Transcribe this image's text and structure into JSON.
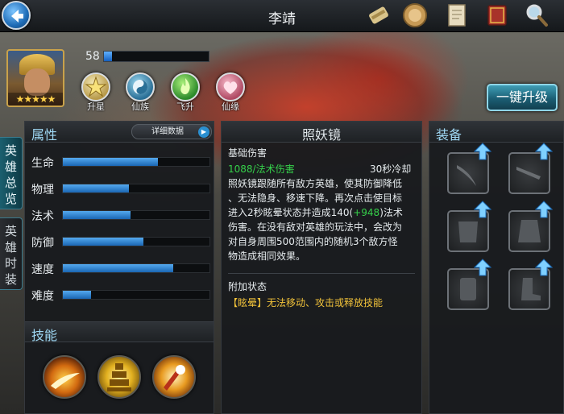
{
  "header": {
    "title": "李靖",
    "icons": [
      "scroll-icon",
      "badge-icon",
      "document-icon",
      "book-icon",
      "magnifier-icon"
    ]
  },
  "hero": {
    "stars": "★★★★★",
    "level": "58",
    "level_progress": 0.08,
    "actions": [
      {
        "label": "升星",
        "icon": "star-icon"
      },
      {
        "label": "仙族",
        "icon": "taiji-icon"
      },
      {
        "label": "飞升",
        "icon": "flame-icon"
      },
      {
        "label": "仙缘",
        "icon": "heart-icon"
      }
    ],
    "upgrade_button": "一键升级"
  },
  "side_tabs": [
    {
      "label": "英雄总览",
      "active": true
    },
    {
      "label": "英雄时装",
      "active": false
    }
  ],
  "attributes": {
    "title": "属性",
    "detail_button": "详细数据",
    "stats": [
      {
        "name": "生命",
        "value": 0.65
      },
      {
        "name": "物理",
        "value": 0.45
      },
      {
        "name": "法术",
        "value": 0.46
      },
      {
        "name": "防御",
        "value": 0.55
      },
      {
        "name": "速度",
        "value": 0.75
      },
      {
        "name": "难度",
        "value": 0.19
      }
    ]
  },
  "skills": {
    "title": "技能",
    "icons": [
      "slash-skill-icon",
      "pagoda-skill-icon",
      "burst-skill-icon"
    ]
  },
  "skill_detail": {
    "title": "照妖镜",
    "type": "基础伤害",
    "damage_text": "1088/法术伤害",
    "cooldown": "30秒冷却",
    "desc_1": "照妖镜跟随所有敌方英雄，使其防御降低",
    "desc_2": "、无法隐身、移速下降。再次点击使目标",
    "desc_3a": "进入2秒眩晕状态并造成140(",
    "desc_3b": "+948",
    "desc_3c": ")法术",
    "desc_4": "伤害。在没有敌对英雄的玩法中，会改为",
    "desc_5": "对自身周围500范围内的随机3个敌方怪",
    "desc_6": "物造成相同效果。",
    "extra_title": "附加状态",
    "extra_text": "【眩晕】无法移动、攻击或释放技能"
  },
  "equipment": {
    "title": "装备",
    "slots": [
      "sword-icon",
      "blade-icon",
      "armor-icon",
      "cloak-icon",
      "bracer-icon",
      "boots-icon"
    ]
  },
  "colors": {
    "accent_blue": "#1a66b4",
    "green_text": "#35d04a",
    "yellow_text": "#f1c23a",
    "upgrade_button": "#1b5e74"
  }
}
